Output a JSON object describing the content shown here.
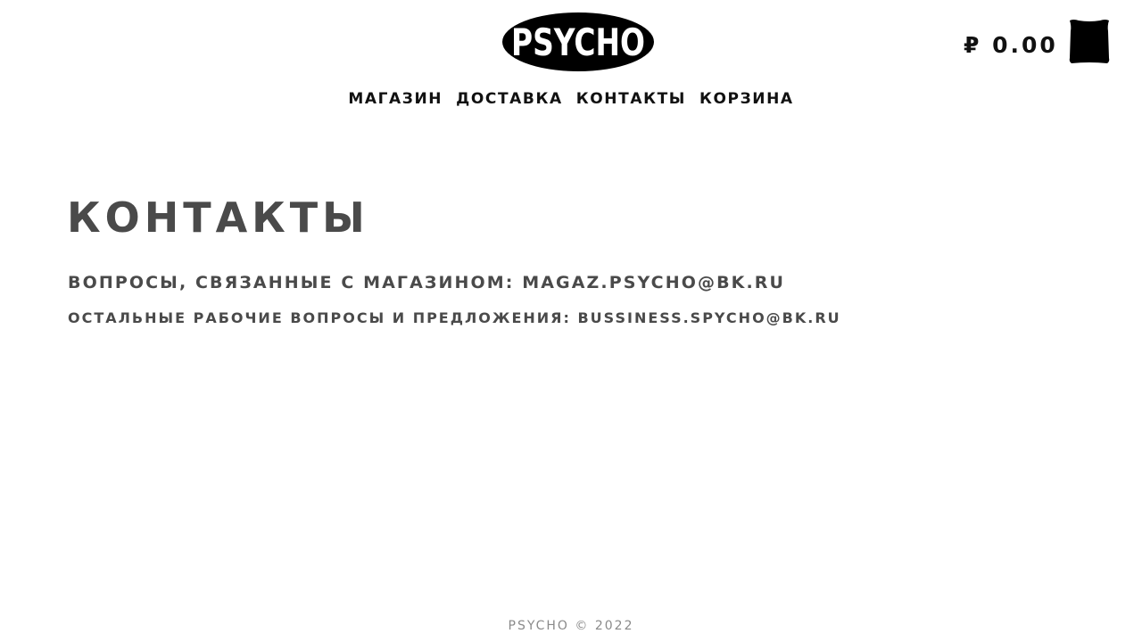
{
  "header": {
    "logo_text": "PSYCHO",
    "cart_total": "₽ 0.00",
    "cart_icon": "shopping-bag-icon"
  },
  "nav": {
    "items": [
      {
        "label": "МАГАЗИН"
      },
      {
        "label": "ДОСТАВКА"
      },
      {
        "label": "КОНТАКТЫ"
      },
      {
        "label": "КОРЗИНА"
      }
    ]
  },
  "main": {
    "title": "КОНТАКТЫ",
    "contacts": [
      {
        "label": "ВОПРОСЫ, СВЯЗАННЫЕ С МАГАЗИНОМ: ",
        "email": "MAGAZ.PSYCHO@BK.RU"
      },
      {
        "label": "ОСТАЛЬНЫЕ РАБОЧИЕ ВОПРОСЫ И ПРЕДЛОЖЕНИЯ: ",
        "email": "BUSSINESS.SPYCHO@BK.RU"
      }
    ]
  },
  "footer": {
    "text": "PSYCHO © 2022"
  },
  "colors": {
    "text_dark": "#111111",
    "heading_gray": "#4a4a4a",
    "footer_gray": "#8a8a8a",
    "background": "#ffffff"
  }
}
